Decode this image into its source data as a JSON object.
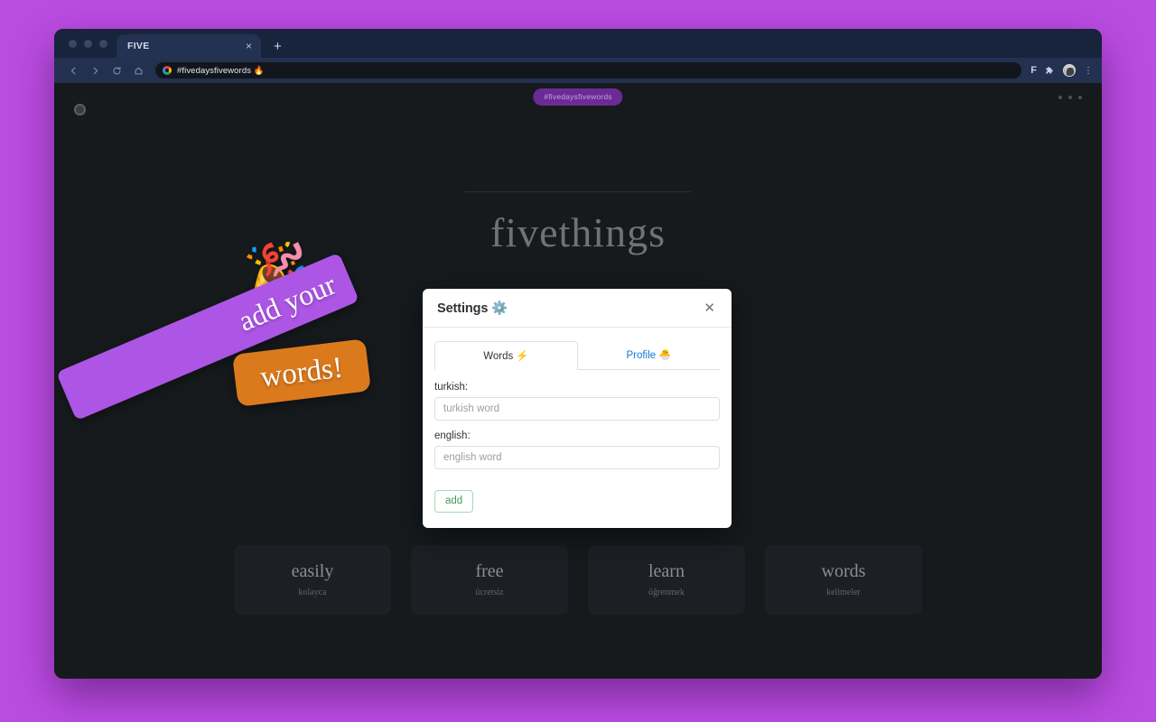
{
  "browser": {
    "tab_title": "FIVE",
    "tab_close_label": "×",
    "new_tab_label": "+",
    "url": "#fivedaysfivewords 🔥",
    "toolbar_icons": {
      "back": "back-arrow",
      "forward": "forward-arrow",
      "reload": "reload",
      "home": "home",
      "extension_f": "F",
      "extension_puzzle": "🧩",
      "profile_avatar": "avatar",
      "menu": "⋮"
    }
  },
  "page": {
    "brand_mark": "logo-mark",
    "hashtag": "#fivedaysfivewords",
    "hero_title": "fivethings",
    "menu_dots": "more-options",
    "sticker": {
      "confetti": "🎉",
      "line1": "add your",
      "line2": "words!"
    },
    "cards": [
      {
        "english": "easily",
        "turkish": "kolayca"
      },
      {
        "english": "free",
        "turkish": "ücretsiz"
      },
      {
        "english": "learn",
        "turkish": "öğrenmek"
      },
      {
        "english": "words",
        "turkish": "kelimeler"
      }
    ]
  },
  "modal": {
    "title": "Settings ⚙️",
    "close_label": "✕",
    "tabs": [
      {
        "label": "Words ⚡",
        "active": true
      },
      {
        "label": "Profile 🐣",
        "active": false
      }
    ],
    "fields": [
      {
        "label": "turkish:",
        "value": "",
        "placeholder": "turkish word"
      },
      {
        "label": "english:",
        "value": "",
        "placeholder": "english word"
      }
    ],
    "submit_label": "add"
  },
  "colors": {
    "desktop_background": "#bb4ce2",
    "page_background": "#161a1d",
    "accent_purple": "#ad56e6",
    "accent_orange": "#db7a1d",
    "pill_purple": "#6b2b95",
    "submit_green": "#3f9b57",
    "link_blue": "#1176d8"
  }
}
